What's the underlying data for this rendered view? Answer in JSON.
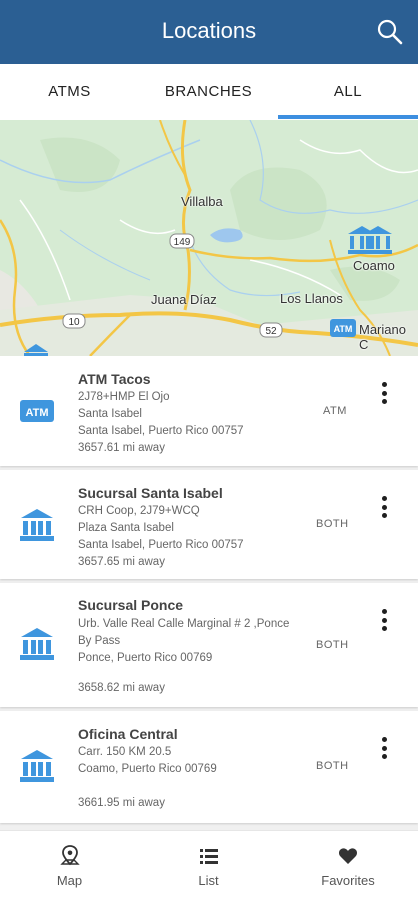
{
  "app": {
    "title": "Locations"
  },
  "tabs": [
    {
      "label": "ATMS"
    },
    {
      "label": "BRANCHES"
    },
    {
      "label": "ALL",
      "selected": true
    }
  ],
  "colors": {
    "appbar": "#2b5f93",
    "accent": "#3d8fe0",
    "icon_blue": "#3f96de"
  },
  "map": {
    "labels": [
      "Villalba",
      "Coamo",
      "Juana Díaz",
      "Los Llanos",
      "Mariano C"
    ],
    "road_shields": [
      "149",
      "10",
      "52"
    ]
  },
  "locations": [
    {
      "name": "ATM Tacos",
      "icon": "atm-icon",
      "lines": [
        "2J78+HMP El Ojo",
        "Santa Isabel",
        "Santa Isabel, Puerto Rico 00757",
        "3657.61 mi away"
      ],
      "type": "ATM"
    },
    {
      "name": "Sucursal Santa Isabel",
      "icon": "bank-icon",
      "lines": [
        "CRH Coop, 2J79+WCQ",
        "Plaza Santa Isabel",
        "Santa Isabel, Puerto Rico 00757",
        "3657.65 mi away"
      ],
      "type": "BOTH"
    },
    {
      "name": "Sucursal Ponce",
      "icon": "bank-icon",
      "lines": [
        "Urb. Valle Real Calle Marginal # 2 ,Ponce",
        "By Pass",
        "Ponce, Puerto Rico 00769",
        "3658.62 mi away"
      ],
      "type": "BOTH"
    },
    {
      "name": "Oficina Central",
      "icon": "bank-icon",
      "lines": [
        "Carr. 150 KM 20.5",
        "Coamo, Puerto Rico 00769",
        "3661.95 mi away"
      ],
      "type": "BOTH"
    }
  ],
  "bottom_nav": [
    {
      "label": "Map",
      "icon": "map-pin-icon"
    },
    {
      "label": "List",
      "icon": "list-icon"
    },
    {
      "label": "Favorites",
      "icon": "heart-icon"
    }
  ]
}
